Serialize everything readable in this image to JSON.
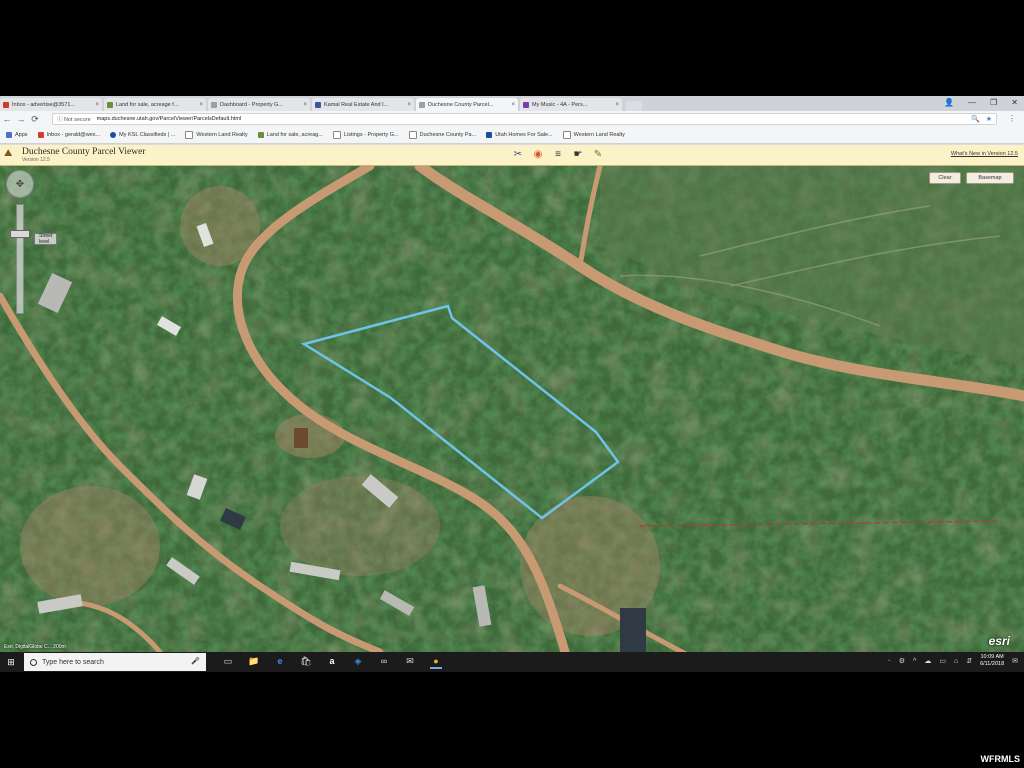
{
  "browser": {
    "tabs": [
      {
        "label": "Inbox - advertise@3571...",
        "color": "#d33b2f",
        "active": false
      },
      {
        "label": "Land for sale, acreage f...",
        "color": "#6a8e3a",
        "active": false
      },
      {
        "label": "Dashboard - Property G...",
        "color": "#9aa0a6",
        "active": false
      },
      {
        "label": "Kamal Real Estate And I...",
        "color": "#3b5998",
        "active": false
      },
      {
        "label": "Duchesne County Parcel...",
        "color": "#9aa0a6",
        "active": true
      },
      {
        "label": "My Music - 4A - Pers...",
        "color": "#7a3ea8",
        "active": false
      }
    ],
    "close_glyph": "×",
    "window_controls": {
      "profile": "👤",
      "minimize": "—",
      "maximize": "❐",
      "close": "✕"
    },
    "nav": {
      "back": "←",
      "forward": "→",
      "reload": "⟳"
    },
    "security_label": "ⓘ Not secure",
    "url": "maps.duchesne.utah.gov/ParcelViewer/ParcelsDefault.html",
    "omni_icons": {
      "zoom": "🔍",
      "star": "★"
    },
    "menu_glyph": "⋮",
    "bookmarks": [
      {
        "label": "Apps",
        "color": "#4a6fd1"
      },
      {
        "label": "Inbox - gerald@wes...",
        "color": "#d33b2f"
      },
      {
        "label": "My KSL Classifieds | ...",
        "color": "#1a4fa0"
      },
      {
        "label": "Western Land Realty",
        "color": "#ffffff"
      },
      {
        "label": "Land for sale, acreag...",
        "color": "#6a8e3a"
      },
      {
        "label": "Listings - Property G...",
        "color": "#ffffff"
      },
      {
        "label": "Duchesne County Pa...",
        "color": "#ffffff"
      },
      {
        "label": "Utah Homes For Sale...",
        "color": "#1a4fa0"
      },
      {
        "label": "Western Land Realty",
        "color": "#ffffff"
      }
    ]
  },
  "app": {
    "logo_glyph": "⛰",
    "title": "Duchesne County Parcel Viewer",
    "version": "Version 12.5",
    "whats_new": "What's New in Version 12.5",
    "tool_icons": [
      "✂",
      "◉",
      "≡",
      "☛",
      "✎"
    ]
  },
  "map": {
    "buttons": {
      "clear": "Clear",
      "basemap": "Basemap"
    },
    "zoom_icon": "✥",
    "zoom_label": "Street level",
    "attribution_logo": "esri",
    "scale_text": "Esri, DigitalGlobe  C...   200m",
    "parcel_color": "#6ec4e8",
    "boundary_line_color": "#b43a2a",
    "road_color": "#c89a74"
  },
  "taskbar": {
    "start_icon": "⊞",
    "search_placeholder": "Type here to search",
    "mic_icon": "🎤",
    "app_icons": [
      "▭",
      "📁",
      "e",
      "🛍",
      "a",
      "◈",
      "∞",
      "✉",
      "●"
    ],
    "tray_icons": [
      "◔",
      "⚙",
      "^",
      "☁",
      "▭",
      "⌂",
      "⇵",
      "✉"
    ],
    "time": "10:09 AM",
    "date": "6/11/2018"
  },
  "watermark": "WFRMLS"
}
